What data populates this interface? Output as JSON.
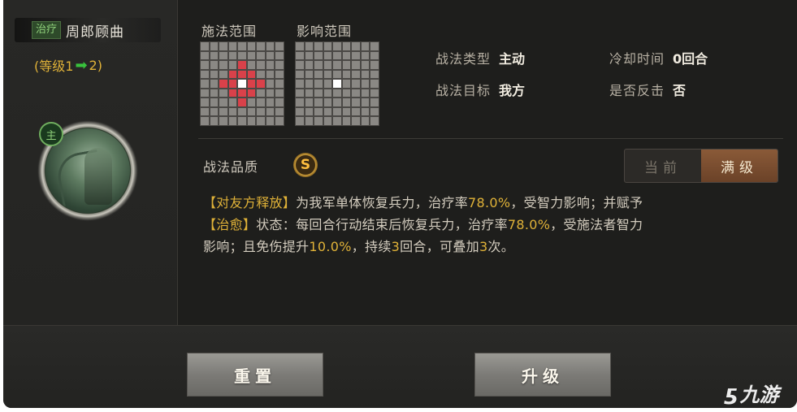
{
  "skill": {
    "tag": "治疗",
    "name": "周郎顾曲",
    "level_prefix": "(等级1",
    "level_arrow": "➡",
    "level_suffix": "2)",
    "main_badge": "主"
  },
  "ranges": {
    "cast_label": "施法范围",
    "effect_label": "影响范围"
  },
  "info": {
    "type_key": "战法类型",
    "type_val": "主动",
    "cooldown_key": "冷却时间",
    "cooldown_val": "0回合",
    "target_key": "战法目标",
    "target_val": "我方",
    "counter_key": "是否反击",
    "counter_val": "否"
  },
  "quality": {
    "label": "战法品质",
    "grade": "S"
  },
  "toggle": {
    "current": "当前",
    "max": "满级",
    "selected": "满级"
  },
  "description": {
    "p1_tag": "【对友方释放】",
    "p1_a": "为我军单体恢复兵力，治疗率",
    "p1_rate": "78.0%",
    "p1_b": "，受智力影响；并赋予",
    "p2_tag": "【治愈】",
    "p2_a": "状态：每回合行动结束后恢复兵力，治疗率",
    "p2_rate": "78.0%",
    "p2_b": "，受施法者智力",
    "p3_a": "影响；且免伤提升",
    "p3_pct": "10.0%",
    "p3_b": "，持续",
    "p3_turns": "3",
    "p3_c": "回合，可叠加",
    "p3_stacks": "3",
    "p3_d": "次。"
  },
  "buttons": {
    "reset": "重置",
    "upgrade": "升级"
  },
  "watermark": {
    "mark": "ƽ",
    "text": "九游"
  },
  "colors": {
    "accent_gold": "#e0b238",
    "heal_green": "#8fd07a",
    "range_red": "#d9414a"
  }
}
